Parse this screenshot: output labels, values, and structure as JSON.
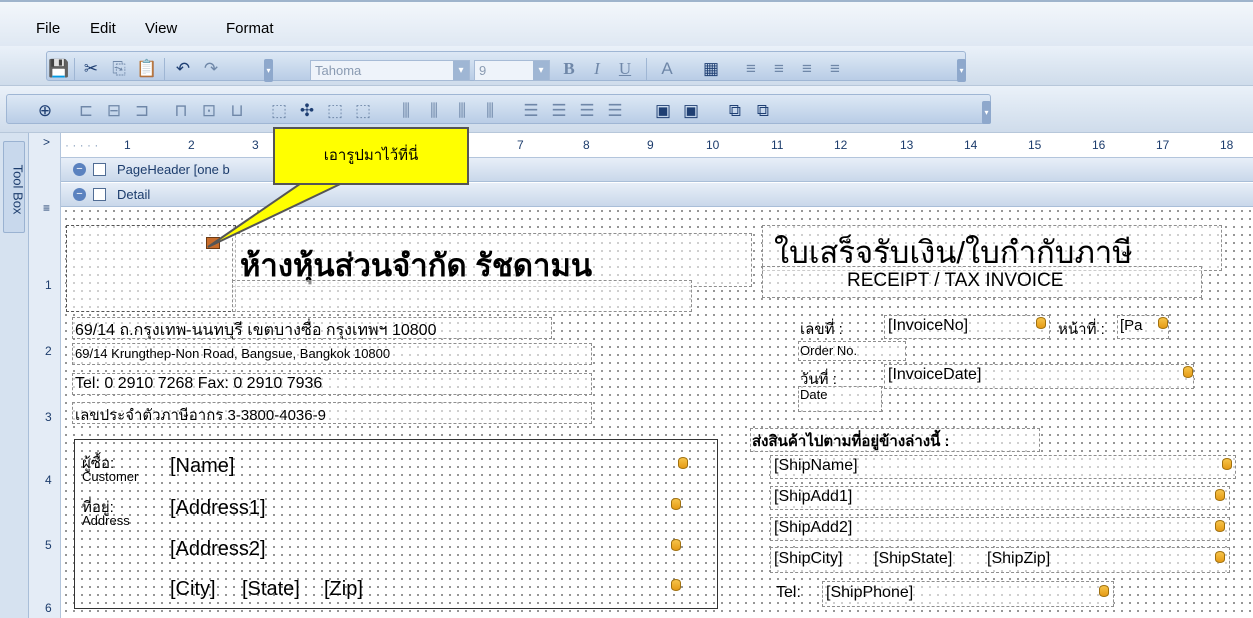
{
  "menu": {
    "file": "File",
    "edit": "Edit",
    "view": "View",
    "format": "Format"
  },
  "toolbar": {
    "font": "Tahoma",
    "size": "9",
    "bold": "B",
    "italic": "I",
    "underline": "U"
  },
  "toolbox_label": "Tool Box",
  "ruler": {
    "h": [
      "1",
      "2",
      "3",
      "7",
      "8",
      "9",
      "10",
      "11",
      "12",
      "13",
      "14",
      "15",
      "16",
      "17",
      "18"
    ],
    "v": [
      "1",
      "2",
      "3",
      "4",
      "5",
      "6"
    ]
  },
  "callout": "เอารูปมาไว้ที่นี่",
  "bands": {
    "page_header": "PageHeader [one b",
    "detail": "Detail"
  },
  "report": {
    "company": "ห้างหุ้นส่วนจำกัด รัชดามน",
    "title_th": "ใบเสร็จรับเงิน/ใบกำกับภาษี",
    "title_en": "RECEIPT / TAX INVOICE",
    "addr_th": "69/14 ถ.กรุงเทพ-นนทบุรี เขตบางซื่อ กรุงเทพฯ 10800",
    "addr_en": "69/14 Krungthep-Non Road, Bangsue, Bangkok 10800",
    "tel": "Tel: 0 2910 7268 Fax: 0 2910 7936",
    "taxid": "เลขประจำตัวภาษีอากร 3-3800-4036-9",
    "inv_label": "เลขที่ :",
    "inv_field": "[InvoiceNo]",
    "page_label": "หน้าที่ :",
    "page_field": "[Pa",
    "order_label": "Order No.",
    "date_label": "วันที่ :",
    "date_field": "[InvoiceDate]",
    "date_en": "Date",
    "ship_header": "ส่งสินค้าไปตามที่อยู่ข้างล่างนี้ :",
    "ship_name": "[ShipName]",
    "ship_add1": "[ShipAdd1]",
    "ship_add2": "[ShipAdd2]",
    "ship_city": "[ShipCity]",
    "ship_state": "[ShipState]",
    "ship_zip": "[ShipZip]",
    "ship_tel_label": "Tel:",
    "ship_phone": "[ShipPhone]",
    "cust_label_th": "ผู้ซื้อ:",
    "cust_label_en": "Customer",
    "addr_label_th": "ที่อยู่:",
    "addr_label_en": "Address",
    "name": "[Name]",
    "address1": "[Address1]",
    "address2": "[Address2]",
    "city": "[City]",
    "state": "[State]",
    "zip": "[Zip]"
  }
}
